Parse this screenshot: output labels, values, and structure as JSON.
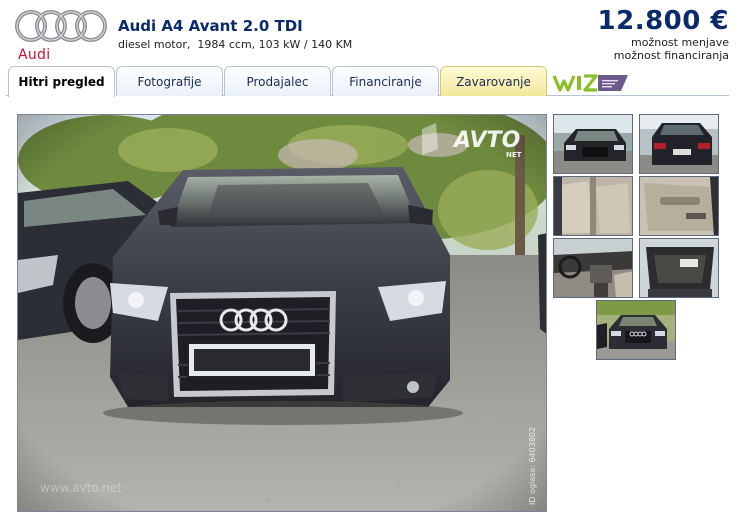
{
  "header": {
    "brand_logo_text": "Audi",
    "title": "Audi A4 Avant 2.0 TDI",
    "subtitle": "diesel motor,  1984 ccm, 103 kW / 140 KM",
    "price": "12.800 €",
    "price_notes": [
      "možnost menjave",
      "možnost financiranja"
    ]
  },
  "tabs": [
    {
      "label": "Hitri pregled",
      "active": true
    },
    {
      "label": "Fotografije",
      "active": false
    },
    {
      "label": "Prodajalec",
      "active": false
    },
    {
      "label": "Financiranje",
      "active": false
    },
    {
      "label": "Zavarovanje",
      "active": false
    }
  ],
  "partner_logo": {
    "icon": "wiz-logo"
  },
  "photo": {
    "watermark_logo": "AVTO",
    "watermark_logo_sub": "NET",
    "watermark_id": "ID oglasa: 6403802",
    "watermark_site": "www.avto.net"
  },
  "thumbnails": [
    {
      "icon": "car-front-thumb"
    },
    {
      "icon": "car-rear-thumb"
    },
    {
      "icon": "interior-seats-thumb"
    },
    {
      "icon": "door-panel-thumb"
    },
    {
      "icon": "dashboard-thumb"
    },
    {
      "icon": "trunk-thumb"
    },
    {
      "icon": "car-front-thumb-2"
    }
  ],
  "colors": {
    "title_blue": "#0a2a6b",
    "audi_red": "#c8102e",
    "tab_border": "#b5c4d8",
    "insurance_tab": "#f3e79a",
    "car_body": "#3b3d46"
  }
}
